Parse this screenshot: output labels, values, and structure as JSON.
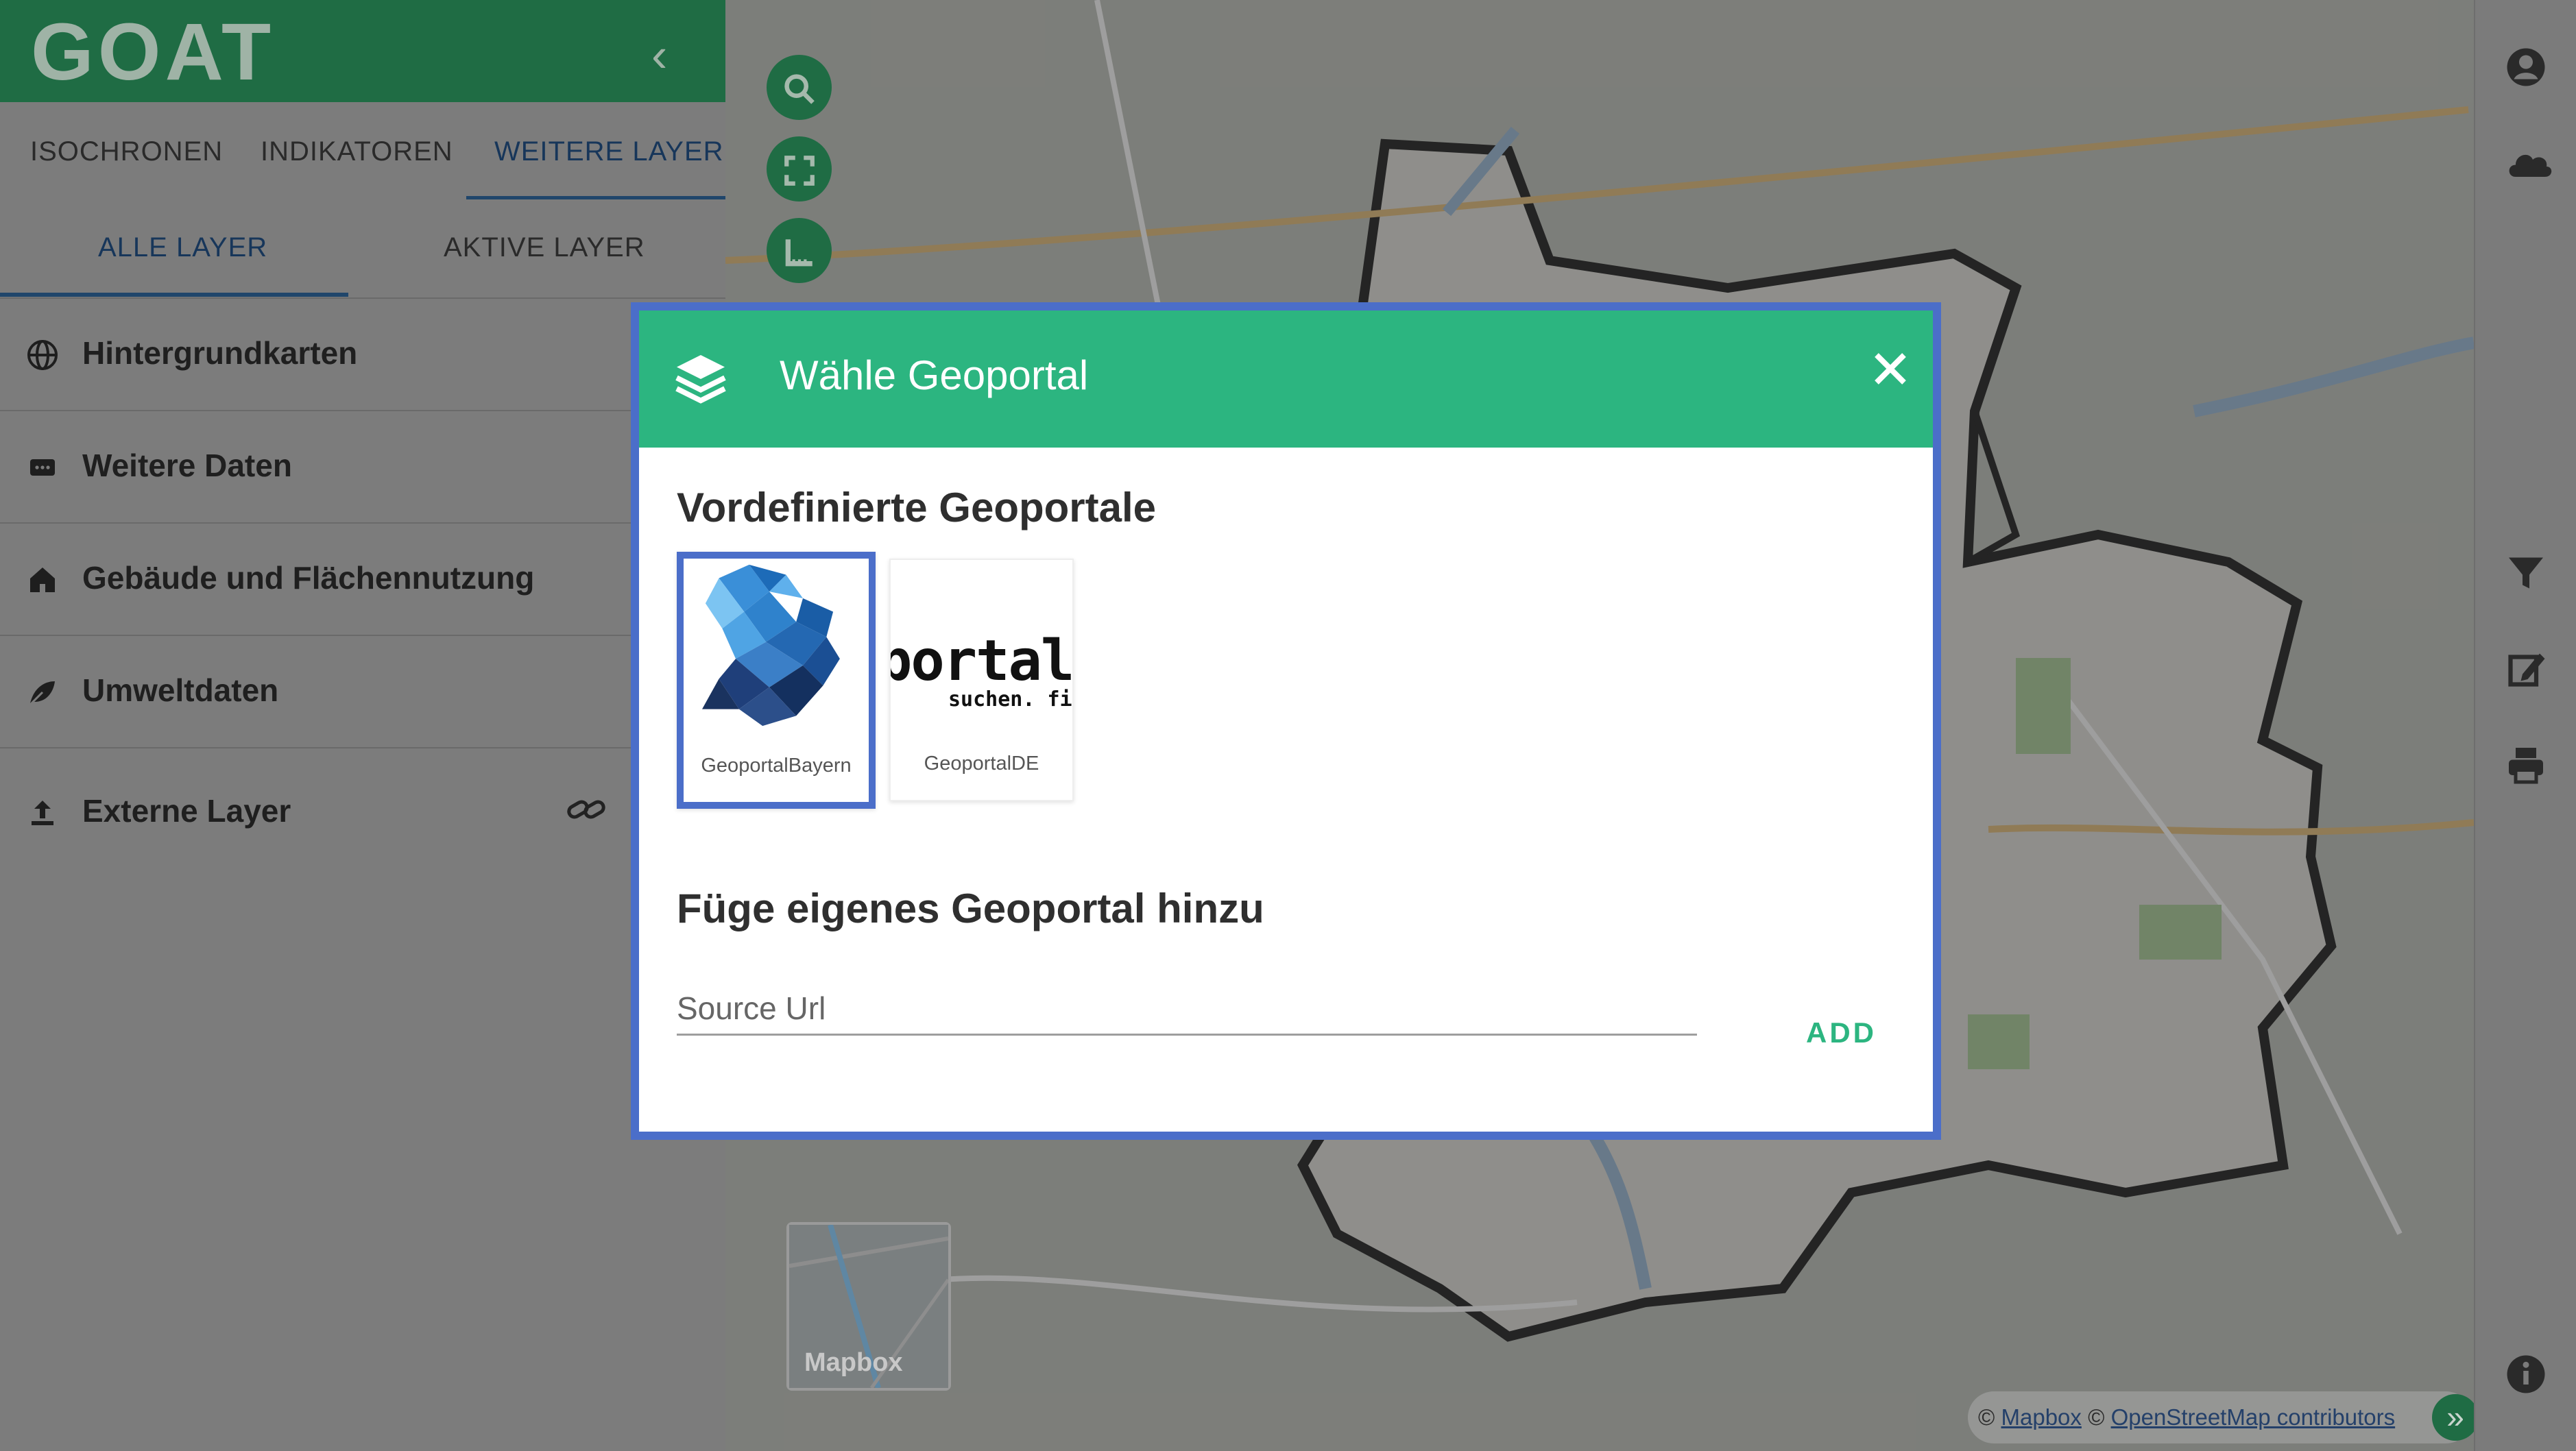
{
  "app": {
    "logo_text": "GOAT"
  },
  "sidebar": {
    "collapse_icon": "chevron-left-icon",
    "tabs": [
      {
        "label": "ISOCHRONEN"
      },
      {
        "label": "INDIKATOREN"
      },
      {
        "label": "WEITERE LAYER",
        "active": true
      }
    ],
    "subtabs": [
      {
        "label": "ALLE LAYER",
        "active": true
      },
      {
        "label": "AKTIVE LAYER"
      }
    ],
    "layers": [
      {
        "label": "Hintergrundkarten",
        "icon": "globe-icon"
      },
      {
        "label": "Weitere Daten",
        "icon": "dataset-icon"
      },
      {
        "label": "Gebäude und Flächennutzung",
        "icon": "house-icon"
      },
      {
        "label": "Umweltdaten",
        "icon": "leaf-icon"
      },
      {
        "label": "Externe Layer",
        "icon": "upload-icon",
        "action_icon": "link-icon"
      }
    ]
  },
  "map_controls": [
    "search-icon",
    "fullscreen-icon",
    "measure-icon"
  ],
  "minimap": {
    "label": "Mapbox"
  },
  "attribution": {
    "sep": "©",
    "mapbox": "Mapbox",
    "osm": "OpenStreetMap contributors",
    "expand": "»"
  },
  "right_toolbar": [
    "account-icon",
    "cloud-icon",
    "filter-icon",
    "edit-icon",
    "print-icon",
    "info-icon"
  ],
  "dialog": {
    "title": "Wähle Geoportal",
    "header_icon": "layers-icon",
    "close_icon": "close-icon",
    "predefined_heading": "Vordefinierte Geoportale",
    "portals": [
      {
        "name": "GeoportalBayern",
        "selected": true
      },
      {
        "name": "GeoportalDE",
        "logo_text": "portal.",
        "logo_sub": "suchen. find"
      }
    ],
    "custom_heading": "Füge eigenes Geoportal hinzu",
    "url_placeholder": "Source Url",
    "url_value": "",
    "add_label": "ADD"
  },
  "colors": {
    "accent": "#2cb580",
    "selection": "#4b6ec9",
    "brand_dark": "#1f6c44"
  }
}
